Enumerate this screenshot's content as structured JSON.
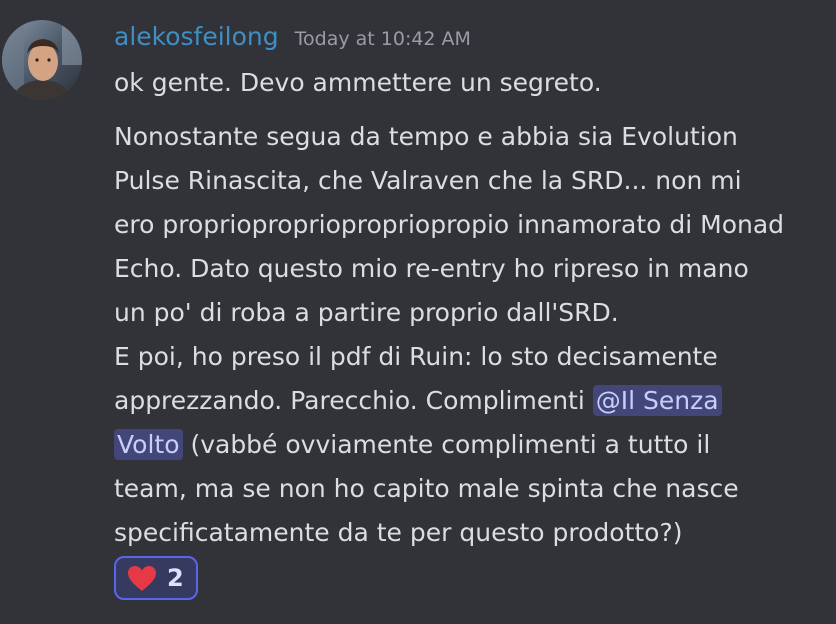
{
  "message": {
    "username": "alekosfeilong",
    "timestamp": "Today at 10:42 AM",
    "first_line": "ok gente. Devo ammettere un segreto.",
    "body_lines": [
      "Nonostante segua da tempo e abbia sia Evolution",
      "Pulse Rinascita, che Valraven che la SRD... non mi",
      "ero propriopropriopropriopropio innamorato di Monad",
      "Echo. Dato questo mio re-entry ho ripreso in mano",
      "un po' di roba a partire proprio dall'SRD.",
      "E poi, ho preso il pdf di Ruin: lo sto decisamente"
    ],
    "line7_before": "apprezzando. Parecchio. Complimenti ",
    "mention_part1": "@Il Senza",
    "mention_part2": "Volto",
    "line8_after": " (vabbé ovviamente complimenti a tutto il",
    "body_lines_end": [
      "team, ma se non ho capito male spinta che nasce",
      "specificatamente da te per questo prodotto?)"
    ]
  },
  "reactions": [
    {
      "emoji": "heart-icon",
      "count": "2",
      "color": "#e63946"
    }
  ],
  "colors": {
    "background": "#323339",
    "username": "#3e8fc4",
    "text": "#dbdee1",
    "timestamp": "#9a9ba3",
    "mention_bg": "#434679",
    "mention_text": "#c9cdfb",
    "reaction_border": "#5a65ea"
  }
}
